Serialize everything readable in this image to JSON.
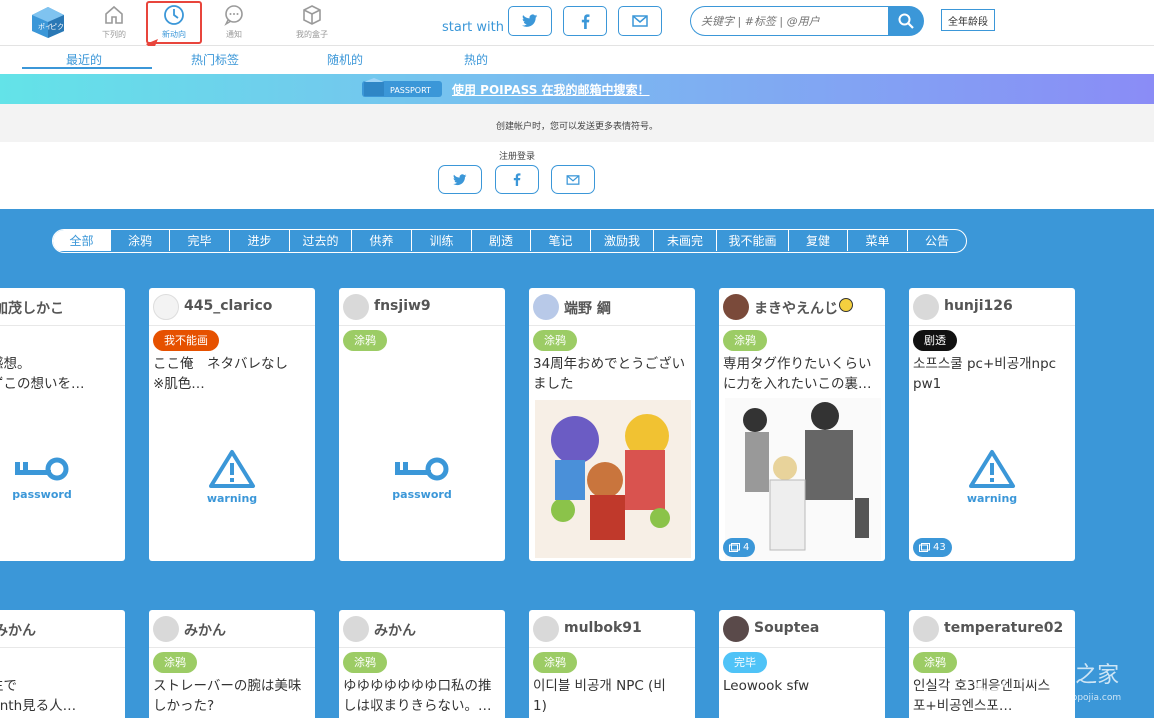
{
  "header": {
    "nav": [
      {
        "label": "下列的",
        "icon": "home-icon"
      },
      {
        "label": "新动向",
        "icon": "clock-icon"
      },
      {
        "label": "通知",
        "icon": "chat-bubble-icon"
      },
      {
        "label": "我的盒子",
        "icon": "box-icon"
      }
    ],
    "start_with": "start with",
    "search_placeholder": "关键字 | #标签 | @用户",
    "age_label": "全年龄段"
  },
  "tabs": [
    "最近的",
    "热门标签",
    "随机的",
    "热的"
  ],
  "banner": {
    "badge": "PASSPORT",
    "link": "使用 POIPASS 在我的邮箱中搜索！"
  },
  "info": {
    "notice": "创建帐户时，您可以发送更多表情符号。",
    "login_label": "注册登录"
  },
  "categories": [
    "全部",
    "涂鸦",
    "完毕",
    "进步",
    "过去的",
    "供养",
    "训练",
    "剧透",
    "笔记",
    "激励我",
    "未画完",
    "我不能画",
    "复健",
    "菜单",
    "公告"
  ],
  "cards": [
    {
      "user": "加茂しかこ",
      "badge": "",
      "badge_color": "#9ccc65",
      "text": "の話感想。\nあえずこの想いを…",
      "icon": "password",
      "icon_label": "password",
      "count": ""
    },
    {
      "user": "445_clarico",
      "badge": "我不能画",
      "badge_color": "#e65100",
      "text": "ここ俺　ネタバレなし\n※肌色…",
      "icon": "warning",
      "icon_label": "warning",
      "count": ""
    },
    {
      "user": "fnsjiw9",
      "badge": "涂鸦",
      "badge_color": "#9ccc65",
      "text": "",
      "icon": "password",
      "icon_label": "password",
      "count": ""
    },
    {
      "user": "端野 綱",
      "badge": "涂鸦",
      "badge_color": "#9ccc65",
      "text": "34周年おめでとうござい\nました",
      "icon": "image",
      "icon_label": "",
      "count": ""
    },
    {
      "user": "まきやえんじ",
      "badge": "涂鸦",
      "badge_color": "#9ccc65",
      "text": "専用タグ作りたいくらい\nに力を入れたいこの裏…",
      "icon": "image",
      "icon_label": "",
      "count": "4"
    },
    {
      "user": "hunji126",
      "badge": "剧透",
      "badge_color": "#111111",
      "text": "소프스쿨 pc+비공개npc\npw1",
      "icon": "warning",
      "icon_label": "warning",
      "count": "43"
    },
    {
      "user": "みかん",
      "badge": "",
      "badge_color": "#9ccc65",
      "text": "小学生で\nkymonth見る人…",
      "icon": "",
      "icon_label": "",
      "count": ""
    },
    {
      "user": "みかん",
      "badge": "涂鸦",
      "badge_color": "#9ccc65",
      "text": "ストレーバーの腕は美味\nしかった?",
      "icon": "",
      "icon_label": "",
      "count": ""
    },
    {
      "user": "みかん",
      "badge": "涂鸦",
      "badge_color": "#9ccc65",
      "text": "ゆゆゆゆゆゆゆ口私の推\nしは収まりきらない。…",
      "icon": "",
      "icon_label": "",
      "count": ""
    },
    {
      "user": "mulbok91",
      "badge": "涂鸦",
      "badge_color": "#9ccc65",
      "text": "이디블 비공개 NPC (비\n1)",
      "icon": "",
      "icon_label": "",
      "count": ""
    },
    {
      "user": "Souptea",
      "badge": "完毕",
      "badge_color": "#4fc3f7",
      "text": "Leowook sfw",
      "icon": "",
      "icon_label": "",
      "count": ""
    },
    {
      "user": "temperature02",
      "badge": "涂鸦",
      "badge_color": "#9ccc65",
      "text": "인실각 호3대응엔피씨스\n포+비공엔스포…",
      "icon": "",
      "icon_label": "",
      "count": ""
    }
  ],
  "watermark": {
    "brand": "OPPO之家",
    "url": "www.oppojia.com"
  },
  "colors": {
    "accent": "#3b97d8",
    "annotation": "#e8453c"
  }
}
